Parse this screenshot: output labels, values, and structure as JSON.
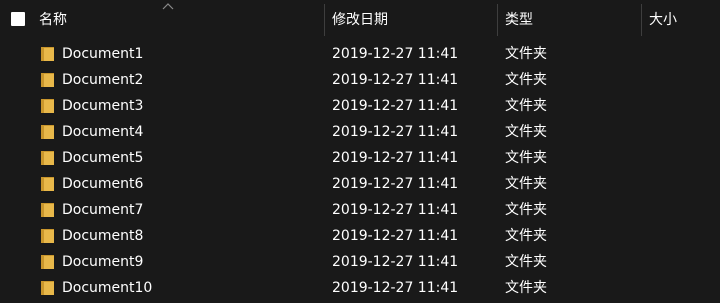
{
  "header": {
    "name_label": "名称",
    "date_label": "修改日期",
    "type_label": "类型",
    "size_label": "大小",
    "sort_icon": "chevron-up-icon"
  },
  "files": [
    {
      "name": "Document1",
      "modified": "2019-12-27 11:41",
      "type": "文件夹",
      "icon": "folder-icon"
    },
    {
      "name": "Document2",
      "modified": "2019-12-27 11:41",
      "type": "文件夹",
      "icon": "folder-icon"
    },
    {
      "name": "Document3",
      "modified": "2019-12-27 11:41",
      "type": "文件夹",
      "icon": "folder-icon"
    },
    {
      "name": "Document4",
      "modified": "2019-12-27 11:41",
      "type": "文件夹",
      "icon": "folder-icon"
    },
    {
      "name": "Document5",
      "modified": "2019-12-27 11:41",
      "type": "文件夹",
      "icon": "folder-icon"
    },
    {
      "name": "Document6",
      "modified": "2019-12-27 11:41",
      "type": "文件夹",
      "icon": "folder-icon"
    },
    {
      "name": "Document7",
      "modified": "2019-12-27 11:41",
      "type": "文件夹",
      "icon": "folder-icon"
    },
    {
      "name": "Document8",
      "modified": "2019-12-27 11:41",
      "type": "文件夹",
      "icon": "folder-icon"
    },
    {
      "name": "Document9",
      "modified": "2019-12-27 11:41",
      "type": "文件夹",
      "icon": "folder-icon"
    },
    {
      "name": "Document10",
      "modified": "2019-12-27 11:41",
      "type": "文件夹",
      "icon": "folder-icon"
    }
  ],
  "colors": {
    "background": "#191919",
    "text": "#ffffff",
    "divider": "#3e3e3e",
    "folder_body": "#e8b84a",
    "folder_back": "#c9962c"
  }
}
